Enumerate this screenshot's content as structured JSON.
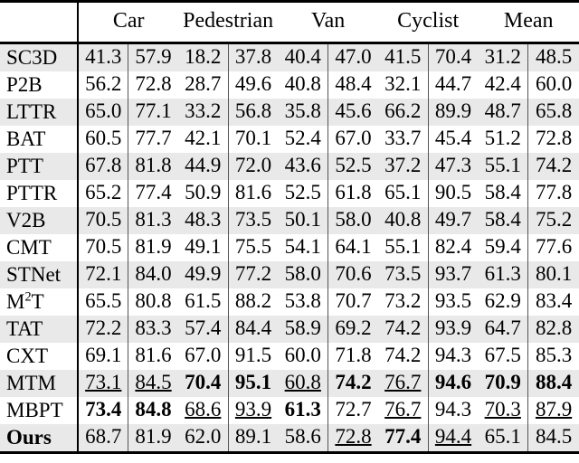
{
  "table": {
    "corner_label": "",
    "columns": [
      "Car",
      "Pedestrian",
      "Van",
      "Cyclist",
      "Mean"
    ],
    "rows": [
      {
        "method": "SC3D",
        "method_sup": "",
        "shaded": true,
        "bold_method": false,
        "values": [
          "41.3",
          "57.9",
          "18.2",
          "37.8",
          "40.4",
          "47.0",
          "41.5",
          "70.4",
          "31.2",
          "48.5"
        ],
        "styles": [
          "",
          "",
          "",
          "",
          "",
          "",
          "",
          "",
          "",
          ""
        ]
      },
      {
        "method": "P2B",
        "method_sup": "",
        "shaded": false,
        "bold_method": false,
        "values": [
          "56.2",
          "72.8",
          "28.7",
          "49.6",
          "40.8",
          "48.4",
          "32.1",
          "44.7",
          "42.4",
          "60.0"
        ],
        "styles": [
          "",
          "",
          "",
          "",
          "",
          "",
          "",
          "",
          "",
          ""
        ]
      },
      {
        "method": "LTTR",
        "method_sup": "",
        "shaded": true,
        "bold_method": false,
        "values": [
          "65.0",
          "77.1",
          "33.2",
          "56.8",
          "35.8",
          "45.6",
          "66.2",
          "89.9",
          "48.7",
          "65.8"
        ],
        "styles": [
          "",
          "",
          "",
          "",
          "",
          "",
          "",
          "",
          "",
          ""
        ]
      },
      {
        "method": "BAT",
        "method_sup": "",
        "shaded": false,
        "bold_method": false,
        "values": [
          "60.5",
          "77.7",
          "42.1",
          "70.1",
          "52.4",
          "67.0",
          "33.7",
          "45.4",
          "51.2",
          "72.8"
        ],
        "styles": [
          "",
          "",
          "",
          "",
          "",
          "",
          "",
          "",
          "",
          ""
        ]
      },
      {
        "method": "PTT",
        "method_sup": "",
        "shaded": true,
        "bold_method": false,
        "values": [
          "67.8",
          "81.8",
          "44.9",
          "72.0",
          "43.6",
          "52.5",
          "37.2",
          "47.3",
          "55.1",
          "74.2"
        ],
        "styles": [
          "",
          "",
          "",
          "",
          "",
          "",
          "",
          "",
          "",
          ""
        ]
      },
      {
        "method": "PTTR",
        "method_sup": "",
        "shaded": false,
        "bold_method": false,
        "values": [
          "65.2",
          "77.4",
          "50.9",
          "81.6",
          "52.5",
          "61.8",
          "65.1",
          "90.5",
          "58.4",
          "77.8"
        ],
        "styles": [
          "",
          "",
          "",
          "",
          "",
          "",
          "",
          "",
          "",
          ""
        ]
      },
      {
        "method": "V2B",
        "method_sup": "",
        "shaded": true,
        "bold_method": false,
        "values": [
          "70.5",
          "81.3",
          "48.3",
          "73.5",
          "50.1",
          "58.0",
          "40.8",
          "49.7",
          "58.4",
          "75.2"
        ],
        "styles": [
          "",
          "",
          "",
          "",
          "",
          "",
          "",
          "",
          "",
          ""
        ]
      },
      {
        "method": "CMT",
        "method_sup": "",
        "shaded": false,
        "bold_method": false,
        "values": [
          "70.5",
          "81.9",
          "49.1",
          "75.5",
          "54.1",
          "64.1",
          "55.1",
          "82.4",
          "59.4",
          "77.6"
        ],
        "styles": [
          "",
          "",
          "",
          "",
          "",
          "",
          "",
          "",
          "",
          ""
        ]
      },
      {
        "method": "STNet",
        "method_sup": "",
        "shaded": true,
        "bold_method": false,
        "values": [
          "72.1",
          "84.0",
          "49.9",
          "77.2",
          "58.0",
          "70.6",
          "73.5",
          "93.7",
          "61.3",
          "80.1"
        ],
        "styles": [
          "",
          "",
          "",
          "",
          "",
          "",
          "",
          "",
          "",
          ""
        ]
      },
      {
        "method": "M",
        "method_sup": "2",
        "method_tail": "T",
        "shaded": false,
        "bold_method": false,
        "values": [
          "65.5",
          "80.8",
          "61.5",
          "88.2",
          "53.8",
          "70.7",
          "73.2",
          "93.5",
          "62.9",
          "83.4"
        ],
        "styles": [
          "",
          "",
          "",
          "",
          "",
          "",
          "",
          "",
          "",
          ""
        ]
      },
      {
        "method": "TAT",
        "method_sup": "",
        "shaded": true,
        "bold_method": false,
        "values": [
          "72.2",
          "83.3",
          "57.4",
          "84.4",
          "58.9",
          "69.2",
          "74.2",
          "93.9",
          "64.7",
          "82.8"
        ],
        "styles": [
          "",
          "",
          "",
          "",
          "",
          "",
          "",
          "",
          "",
          ""
        ]
      },
      {
        "method": "CXT",
        "method_sup": "",
        "shaded": false,
        "bold_method": false,
        "values": [
          "69.1",
          "81.6",
          "67.0",
          "91.5",
          "60.0",
          "71.8",
          "74.2",
          "94.3",
          "67.5",
          "85.3"
        ],
        "styles": [
          "",
          "",
          "",
          "",
          "",
          "",
          "",
          "",
          "",
          ""
        ]
      },
      {
        "method": "MTM",
        "method_sup": "",
        "shaded": true,
        "bold_method": false,
        "values": [
          "73.1",
          "84.5",
          "70.4",
          "95.1",
          "60.8",
          "74.2",
          "76.7",
          "94.6",
          "70.9",
          "88.4"
        ],
        "styles": [
          "u",
          "u",
          "b",
          "b",
          "u",
          "b",
          "u",
          "b",
          "b",
          "b"
        ]
      },
      {
        "method": "MBPT",
        "method_sup": "",
        "shaded": false,
        "bold_method": false,
        "values": [
          "73.4",
          "84.8",
          "68.6",
          "93.9",
          "61.3",
          "72.7",
          "76.7",
          "94.3",
          "70.3",
          "87.9"
        ],
        "styles": [
          "b",
          "b",
          "u",
          "u",
          "b",
          "",
          "u",
          "",
          "u",
          "u"
        ]
      },
      {
        "method": "Ours",
        "method_sup": "",
        "shaded": true,
        "bold_method": true,
        "values": [
          "68.7",
          "81.9",
          "62.0",
          "89.1",
          "58.6",
          "72.8",
          "77.4",
          "94.4",
          "65.1",
          "84.5"
        ],
        "styles": [
          "",
          "",
          "",
          "",
          "",
          "u",
          "b",
          "u",
          "",
          ""
        ]
      }
    ]
  },
  "legend": {
    "bold_meaning": "best",
    "underline_meaning": "second best"
  },
  "colors": {
    "stripe": "#e9e9e9",
    "background": "#ffffff",
    "rule": "#000000",
    "text": "#000000"
  }
}
